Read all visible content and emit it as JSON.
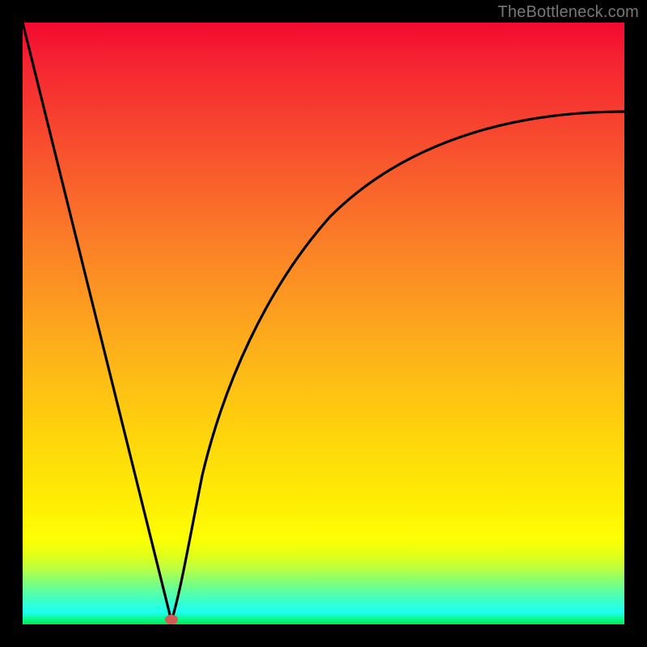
{
  "attribution": "TheBottleneck.com",
  "colors": {
    "frame": "#000000",
    "gradient_stops": [
      {
        "pos": 0,
        "hex": "#f40930"
      },
      {
        "pos": 0.06,
        "hex": "#f52232"
      },
      {
        "pos": 0.18,
        "hex": "#f7472f"
      },
      {
        "pos": 0.36,
        "hex": "#fb7d28"
      },
      {
        "pos": 0.55,
        "hex": "#fdb21a"
      },
      {
        "pos": 0.7,
        "hex": "#fed80a"
      },
      {
        "pos": 0.8,
        "hex": "#ffee04"
      },
      {
        "pos": 0.86,
        "hex": "#fbff05"
      },
      {
        "pos": 0.905,
        "hex": "#bfff3e"
      },
      {
        "pos": 0.945,
        "hex": "#5cffa2"
      },
      {
        "pos": 0.98,
        "hex": "#1efff1"
      },
      {
        "pos": 1.0,
        "hex": "#06e950"
      }
    ],
    "curve": "#000000",
    "marker": "#d35c52"
  },
  "chart_data": {
    "type": "line",
    "title": "",
    "xlabel": "",
    "ylabel": "",
    "xlim": [
      0,
      100
    ],
    "ylim": [
      0,
      100
    ],
    "x_optimum": 25,
    "marker": {
      "x": 25,
      "y": 0
    },
    "description": "Single V-shaped curve: steep linear descent from top-left to a cusp minimum near x≈25 at the baseline, then a concave-increasing rise toward the upper-right. Background is a vertical heatmap gradient (red→yellow→green). A small reddish oval marks the minimum.",
    "series": [
      {
        "name": "bottleneck-curve",
        "x": [
          0,
          5,
          10,
          15,
          20,
          23,
          24.8,
          26,
          28,
          30,
          33,
          37,
          42,
          48,
          55,
          63,
          72,
          82,
          92,
          100
        ],
        "y": [
          100,
          80,
          60,
          40,
          20,
          8,
          0.5,
          3,
          10,
          18,
          28,
          38,
          48,
          57,
          65,
          71,
          76,
          80,
          83,
          85
        ]
      }
    ]
  }
}
